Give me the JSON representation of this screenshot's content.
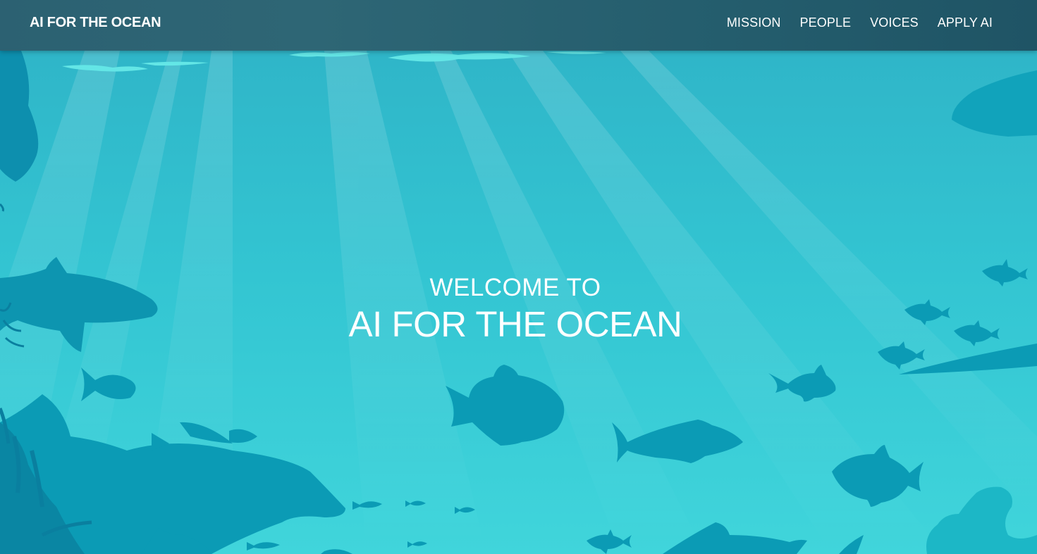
{
  "navbar": {
    "brand": "AI FOR THE OCEAN",
    "links": [
      {
        "label": "MISSION"
      },
      {
        "label": "PEOPLE"
      },
      {
        "label": "VOICES"
      },
      {
        "label": "APPLY AI"
      }
    ]
  },
  "hero": {
    "eyebrow": "WELCOME TO",
    "title": "AI FOR THE OCEAN"
  },
  "colors": {
    "navbar": "#2a6171",
    "water_top": "#2fb4c7",
    "water_bottom": "#3fd4da",
    "silhouette": "#0b9bb5",
    "silhouette_dark": "#0a86a3",
    "surface_foam": "#63e6e6",
    "text": "#ffffff"
  }
}
